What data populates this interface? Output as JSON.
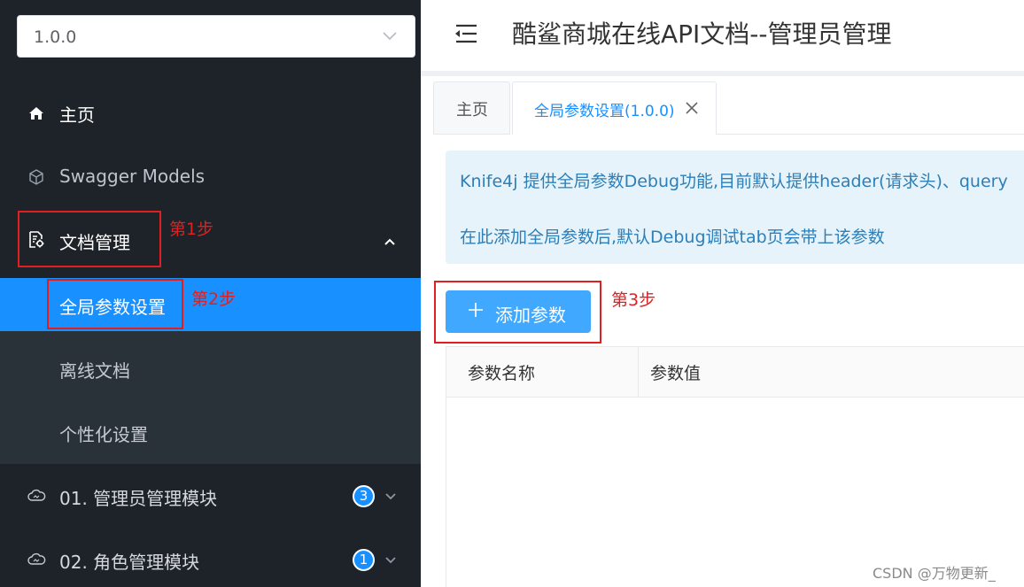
{
  "sidebar": {
    "version_select": {
      "value": "1.0.0"
    },
    "items": [
      {
        "label": "主页",
        "icon": "home-icon"
      },
      {
        "label": "Swagger Models",
        "icon": "cube-icon"
      },
      {
        "label": "文档管理",
        "icon": "document-settings-icon"
      }
    ],
    "submenu": [
      {
        "label": "全局参数设置",
        "active": true
      },
      {
        "label": "离线文档"
      },
      {
        "label": "个性化设置"
      }
    ],
    "modules": [
      {
        "label": "01. 管理员管理模块",
        "count": "3",
        "icon": "cloud-api-icon"
      },
      {
        "label": "02. 角色管理模块",
        "count": "1",
        "icon": "cloud-api-icon"
      }
    ]
  },
  "annotations": {
    "step1": "第1步",
    "step2": "第2步",
    "step3": "第3步",
    "color": "#e02020"
  },
  "header": {
    "title": "酷鲨商城在线API文档--管理员管理"
  },
  "tabs": [
    {
      "label": "主页"
    },
    {
      "label": "全局参数设置(1.0.0)"
    }
  ],
  "alert": {
    "line1": "Knife4j 提供全局参数Debug功能,目前默认提供header(请求头)、query",
    "line2": "在此添加全局参数后,默认Debug调试tab页会带上该参数"
  },
  "add_button": {
    "label": "添加参数"
  },
  "table": {
    "columns": [
      "参数名称",
      "参数值"
    ],
    "rows": []
  },
  "watermark": "CSDN @万物更新_",
  "colors": {
    "sidebar_bg": "#1e2329",
    "submenu_bg": "#2a3239",
    "accent": "#1890ff",
    "button": "#40a9ff",
    "alert_bg": "#e6f3fb"
  }
}
